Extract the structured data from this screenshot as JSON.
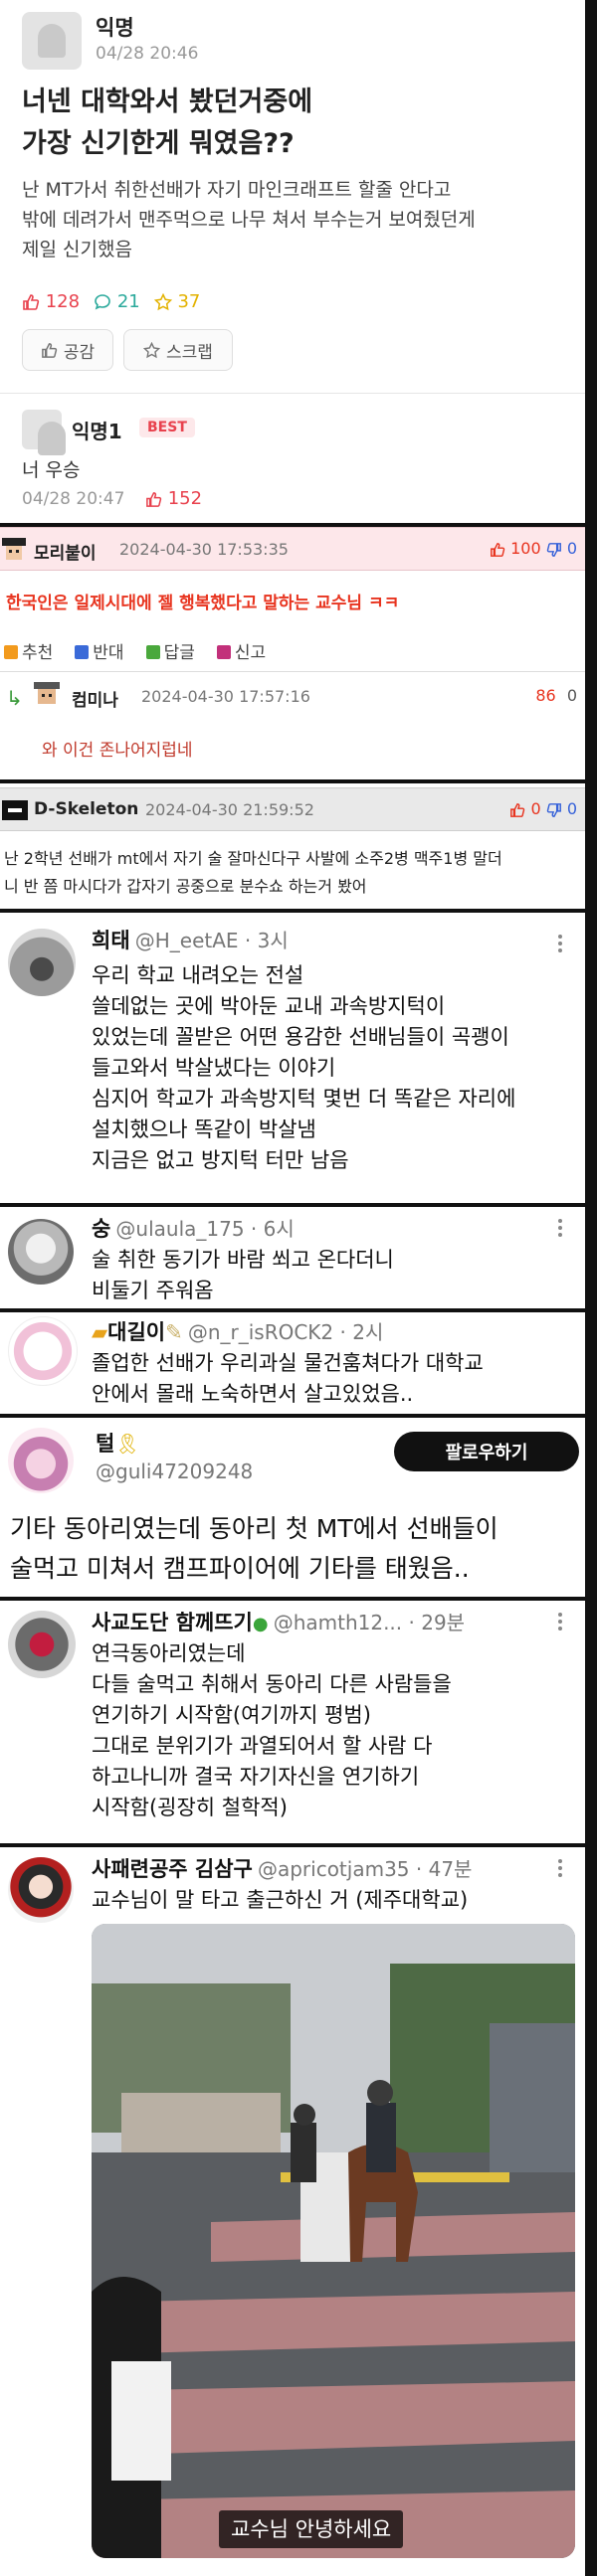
{
  "post": {
    "author": "익명",
    "date": "04/28 20:46",
    "title_line1": "너넨 대학와서 봤던거중에",
    "title_line2": "가장 신기한게 뭐였음??",
    "body": "난 MT가서 취한선배가 자기 마인크래프트 할줄 안다고\n밖에 데려가서 맨주먹으로 나무 쳐서 부수는거 보여줬던게\n제일 신기했음",
    "likes": "128",
    "comments": "21",
    "scraps": "37",
    "like_button": "공감",
    "scrap_button": "스크랩",
    "reply_author": "익명1",
    "best_badge": "BEST",
    "reply_text": "너 우승",
    "reply_date": "04/28 20:47",
    "reply_likes": "152"
  },
  "dc1": {
    "author": "모리붙이",
    "date": "2024-04-30 17:53:35",
    "up": "100",
    "down": "0",
    "text": "한국인은 일제시대에 젤 행복했다고 말하는 교수님 ㅋㅋ",
    "btn_recommend": "추천",
    "btn_oppose": "반대",
    "btn_reply": "답글",
    "btn_report": "신고",
    "reply_author": "컴미나",
    "reply_date": "2024-04-30 17:57:16",
    "reply_up": "86",
    "reply_down": "0",
    "reply_text": "와 이건 존나어지럽네"
  },
  "dc2": {
    "author": "D-Skeleton",
    "date": "2024-04-30 21:59:52",
    "up": "0",
    "down": "0",
    "text": "난 2학년 선배가 mt에서 자기 술 잘마신다구 사발에 소주2병 맥주1병 말더\n니 반 쯤 마시다가 갑자기 공중으로 분수쇼 하는거 봤어"
  },
  "tweets": [
    {
      "name": "희태",
      "handle": "@H_eetAE · 3시",
      "text": "우리 학교 내려오는 전설\n쓸데없는 곳에 박아둔 교내 과속방지턱이\n있었는데 꼴받은 어떤 용감한 선배님들이 곡괭이\n들고와서 박살냈다는 이야기\n심지어 학교가 과속방지턱 몇번 더 똑같은 자리에\n설치했으나 똑같이 박살냄\n지금은 없고 방지턱 터만 남음"
    },
    {
      "name": "숭",
      "handle": "@ulaula_175 · 6시",
      "text": "술 취한 동기가 바람 쐬고 온다더니\n비둘기 주워옴"
    },
    {
      "name": "대길이",
      "handle": "@n_r_isROCK2 · 2시",
      "text": "졸업한 선배가 우리과실 물건훔쳐다가 대학교\n안에서 몰래 노숙하면서 살고있었음.."
    },
    {
      "name": "털",
      "handle": "@guli47209248",
      "follow": "팔로우하기",
      "text": "기타 동아리였는데 동아리 첫 MT에서 선배들이\n술먹고 미쳐서 캠프파이어에 기타를 태웠음.."
    },
    {
      "name": "사교도단 함께뜨기",
      "handle": "@hamth12... · 29분",
      "text": "연극동아리였는데\n다들 술먹고 취해서 동아리 다른 사람들을\n연기하기 시작함(여기까지 평범)\n그대로 분위기가 과열되어서 할 사람 다\n하고나니까 결국 자기자신을 연기하기\n시작함(굉장히 철학적)"
    },
    {
      "name": "사패련공주 김삼구",
      "handle": "@apricotjam35 · 47분",
      "text": "교수님이 말 타고 출근하신 거 (제주대학교)",
      "caption": "교수님 안녕하세요"
    }
  ],
  "colors": {
    "accent_red": "#e8414d",
    "accent_green": "#2aa99b",
    "accent_yellow": "#e3b200",
    "dc_red_text": "#e8341f",
    "dc_blue": "#3561d9"
  },
  "icons": [
    "thumb-up-icon",
    "comment-icon",
    "star-icon",
    "more-dots-icon",
    "reply-arrow-icon",
    "thumb-down-icon"
  ]
}
